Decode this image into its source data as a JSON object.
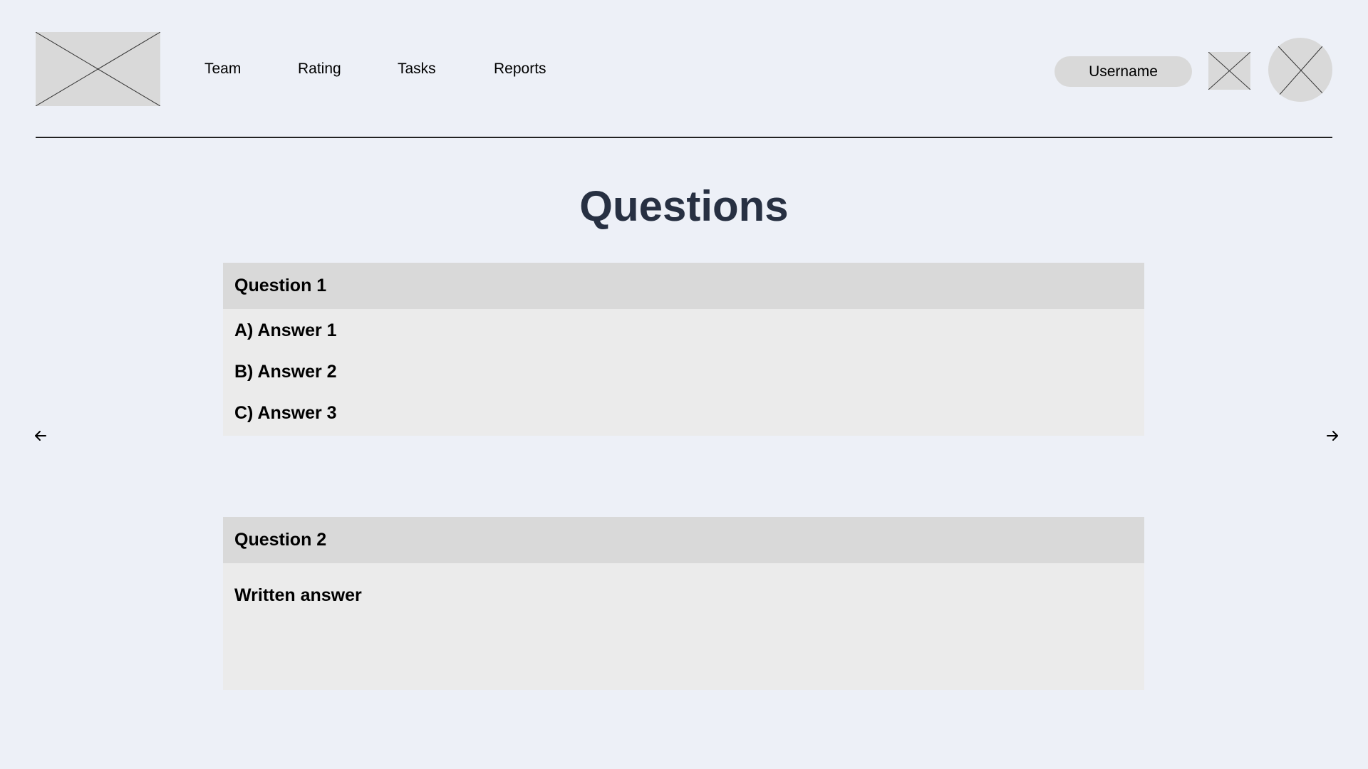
{
  "header": {
    "logo_icon": "image-placeholder-icon",
    "nav": [
      {
        "label": "Team"
      },
      {
        "label": "Rating"
      },
      {
        "label": "Tasks"
      },
      {
        "label": "Reports"
      }
    ],
    "username_label": "Username",
    "action_icon": "image-placeholder-icon",
    "avatar_icon": "avatar-placeholder-icon"
  },
  "main": {
    "title": "Questions",
    "questions": [
      {
        "title": "Question 1",
        "answers": [
          "A) Answer 1",
          "B) Answer 2",
          "C) Answer 3"
        ]
      },
      {
        "title": "Question 2",
        "answer_text": "Written answer"
      }
    ],
    "prev_icon": "arrow-left-icon",
    "next_icon": "arrow-right-icon"
  },
  "colors": {
    "background": "#edf0f7",
    "placeholder": "#d9d9d9",
    "card": "#ebebeb",
    "title": "#273042"
  }
}
